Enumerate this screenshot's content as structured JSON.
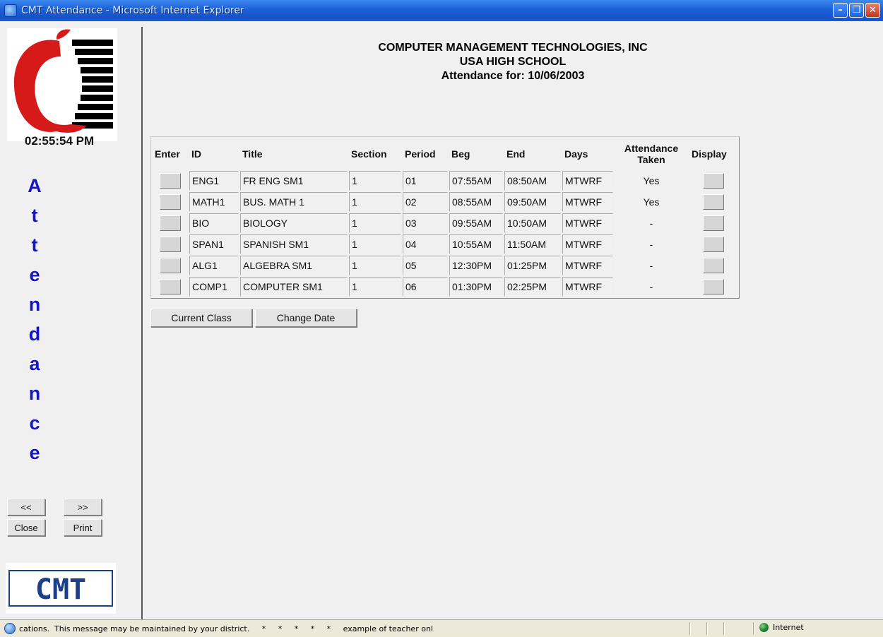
{
  "window": {
    "title": "CMT Attendance - Microsoft Internet Explorer",
    "controls": [
      "minimize",
      "restore",
      "close"
    ]
  },
  "sidebar": {
    "clock": "02:55:54 PM",
    "vertical_word": [
      "A",
      "t",
      "t",
      "e",
      "n",
      "d",
      "a",
      "n",
      "c",
      "e"
    ],
    "buttons": {
      "prev": "<<",
      "next": ">>",
      "close": "Close",
      "print": "Print"
    },
    "logo_text": "CMT"
  },
  "header": {
    "company": "COMPUTER MANAGEMENT TECHNOLOGIES, INC",
    "school": "USA HIGH SCHOOL",
    "attendance_for": "Attendance for: 10/06/2003"
  },
  "table": {
    "columns": [
      "Enter",
      "ID",
      "Title",
      "Section",
      "Period",
      "Beg",
      "End",
      "Days",
      "Attendance Taken",
      "Display"
    ],
    "rows": [
      {
        "id": "ENG1",
        "title": "FR ENG SM1",
        "section": "1",
        "period": "01",
        "beg": "07:55AM",
        "end": "08:50AM",
        "days": "MTWRF",
        "taken": "Yes"
      },
      {
        "id": "MATH1",
        "title": "BUS. MATH 1",
        "section": "1",
        "period": "02",
        "beg": "08:55AM",
        "end": "09:50AM",
        "days": "MTWRF",
        "taken": "Yes"
      },
      {
        "id": "BIO",
        "title": "BIOLOGY",
        "section": "1",
        "period": "03",
        "beg": "09:55AM",
        "end": "10:50AM",
        "days": "MTWRF",
        "taken": "-"
      },
      {
        "id": "SPAN1",
        "title": "SPANISH SM1",
        "section": "1",
        "period": "04",
        "beg": "10:55AM",
        "end": "11:50AM",
        "days": "MTWRF",
        "taken": "-"
      },
      {
        "id": "ALG1",
        "title": "ALGEBRA SM1",
        "section": "1",
        "period": "05",
        "beg": "12:30PM",
        "end": "01:25PM",
        "days": "MTWRF",
        "taken": "-"
      },
      {
        "id": "COMP1",
        "title": "COMPUTER SM1",
        "section": "1",
        "period": "06",
        "beg": "01:30PM",
        "end": "02:25PM",
        "days": "MTWRF",
        "taken": "-"
      }
    ]
  },
  "actions": {
    "current_class": "Current Class",
    "change_date": "Change Date"
  },
  "status_bar": {
    "message": "cations.  This message may be maintained by your district.     *     *     *     *     *     example of teacher onl",
    "zone": "Internet"
  },
  "colors": {
    "accent_blue": "#1515c6",
    "apple_red": "#d61a1a"
  }
}
